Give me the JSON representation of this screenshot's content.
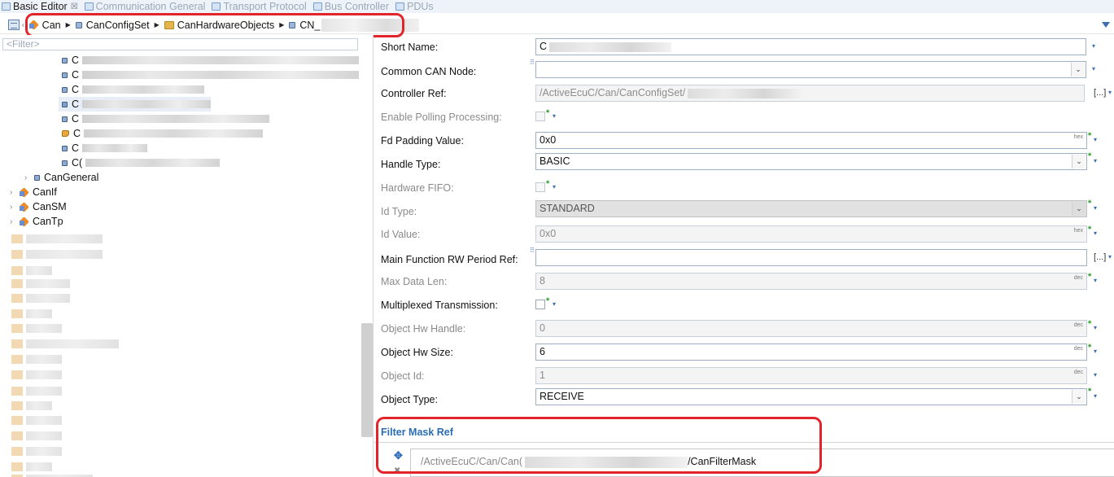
{
  "tabs": [
    {
      "label": "Basic Editor",
      "active": true,
      "closable": true,
      "icon": "editor-icon"
    },
    {
      "label": "Communication General",
      "active": false,
      "icon": "comm-general-icon"
    },
    {
      "label": "Transport Protocol",
      "active": false,
      "icon": "transport-icon"
    },
    {
      "label": "Bus Controller",
      "active": false,
      "icon": "bus-controller-icon"
    },
    {
      "label": "PDUs",
      "active": false,
      "icon": "pdus-icon"
    }
  ],
  "tab_close_glyph": "☒",
  "breadcrumb": {
    "items": [
      "Can",
      "CanConfigSet",
      "CanHardwareObjects",
      "CN_"
    ],
    "separator": "▶"
  },
  "tree": {
    "filter_placeholder": "<Filter>",
    "child_prefix": "C",
    "child_prefix_partial": "C(",
    "items": [
      {
        "label": "CanGeneral"
      },
      {
        "label": "CanIf"
      },
      {
        "label": "CanSM"
      },
      {
        "label": "CanTp"
      }
    ],
    "expand_glyph": "›"
  },
  "form": {
    "short_name": {
      "label": "Short Name:",
      "value": "C"
    },
    "common_can_node": {
      "label": "Common CAN Node:",
      "value": ""
    },
    "controller_ref": {
      "label": "Controller Ref:",
      "value": "/ActiveEcuC/Can/CanConfigSet/",
      "more": "[...]"
    },
    "enable_polling": {
      "label": "Enable Polling Processing:"
    },
    "fd_padding": {
      "label": "Fd Padding Value:",
      "value": "0x0",
      "unit": "hex"
    },
    "handle_type": {
      "label": "Handle Type:",
      "value": "BASIC"
    },
    "hardware_fifo": {
      "label": "Hardware FIFO:"
    },
    "id_type": {
      "label": "Id Type:",
      "value": "STANDARD"
    },
    "id_value": {
      "label": "Id Value:",
      "value": "0x0",
      "unit": "hex"
    },
    "main_function_rw": {
      "label": "Main Function RW Period Ref:",
      "value": "",
      "more": "[...]"
    },
    "max_data_len": {
      "label": "Max Data Len:",
      "value": "8",
      "unit": "dec"
    },
    "multiplexed": {
      "label": "Multiplexed Transmission:"
    },
    "object_hw_handle": {
      "label": "Object Hw Handle:",
      "value": "0",
      "unit": "dec"
    },
    "object_hw_size": {
      "label": "Object Hw Size:",
      "value": "6",
      "unit": "dec"
    },
    "object_id": {
      "label": "Object Id:",
      "value": "1",
      "unit": "dec"
    },
    "object_type": {
      "label": "Object Type:",
      "value": "RECEIVE"
    }
  },
  "filter_mask": {
    "title": "Filter Mask Ref",
    "value_prefix": "/ActiveEcuC/Can/Can(",
    "value_suffix": "/CanFilterMask",
    "add_glyph": "✥",
    "remove_glyph": "✖"
  },
  "glyphs": {
    "star": "*",
    "dropdown": "⌄",
    "small_down": "▾",
    "link": "⠿"
  },
  "colors": {
    "highlight": "#e0262b",
    "accent": "#2a6db5",
    "required_star": "#2a9e2a"
  }
}
